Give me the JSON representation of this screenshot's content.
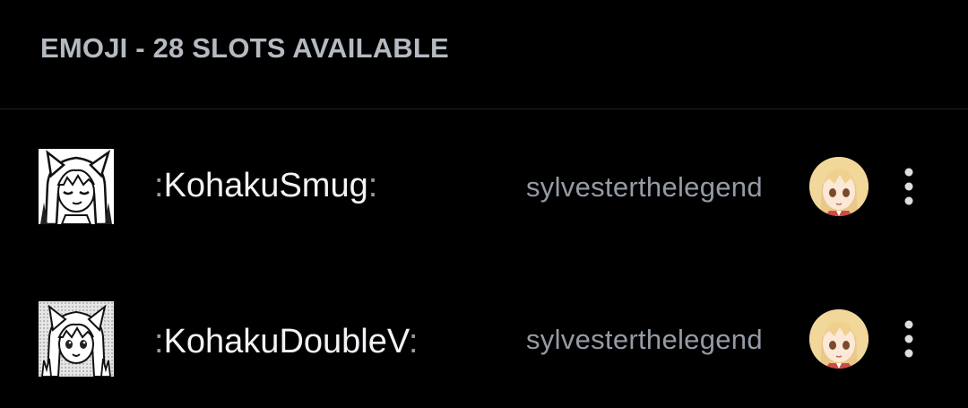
{
  "section": {
    "title": "EMOJI - 28 SLOTS AVAILABLE"
  },
  "emojis": [
    {
      "name": "KohakuSmug",
      "colon_open": ":",
      "colon_close": ":",
      "uploader": "sylvesterthelegend",
      "thumbnail_icon": "kohaku-smug-emoji-image",
      "avatar_icon": "uploader-avatar",
      "more_icon": "more-options-icon"
    },
    {
      "name": "KohakuDoubleV",
      "colon_open": ":",
      "colon_close": ":",
      "uploader": "sylvesterthelegend",
      "thumbnail_icon": "kohaku-double-v-emoji-image",
      "avatar_icon": "uploader-avatar",
      "more_icon": "more-options-icon"
    }
  ],
  "colors": {
    "background": "#000000",
    "header_text": "#b5bac1",
    "primary_text": "#f2f3f5",
    "muted_text": "#949ba4"
  }
}
